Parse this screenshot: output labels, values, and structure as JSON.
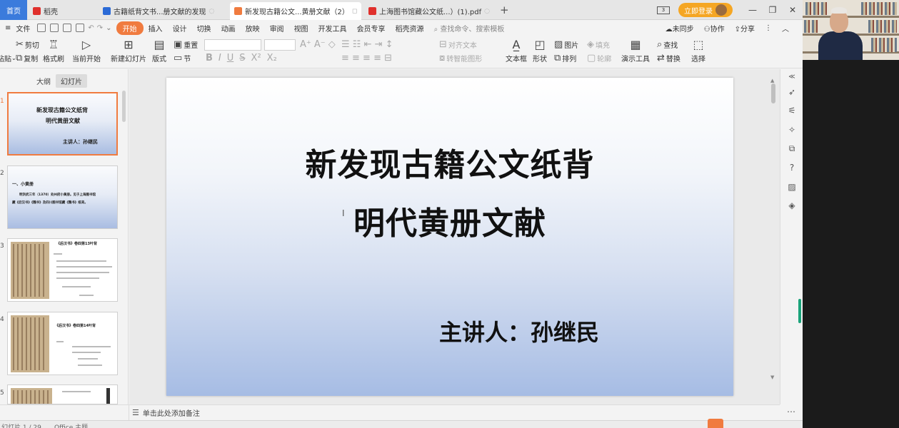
{
  "tabs": [
    {
      "label": "首页",
      "kind": "home"
    },
    {
      "label": "稻壳",
      "icon_color": "#e0302c"
    },
    {
      "label": "古籍纸背文书...册文献的发现",
      "icon_color": "#2b6ad6"
    },
    {
      "label": "新发现古籍公文...黄册文献（2）",
      "icon_color": "#f07b3f",
      "active": true
    },
    {
      "label": "上海图书馆藏公文纸...）(1).pdf",
      "icon_color": "#e0302c"
    }
  ],
  "titlebar": {
    "screen_label": "3",
    "login_label": "立即登录"
  },
  "menu": {
    "file_label": "文件",
    "items": [
      "开始",
      "插入",
      "设计",
      "切换",
      "动画",
      "放映",
      "审阅",
      "视图",
      "开发工具",
      "会员专享",
      "稻壳资源"
    ],
    "active": "开始",
    "search_placeholder": "查找命令、搜索模板",
    "sync_label": "未同步",
    "collab_label": "协作",
    "share_label": "分享"
  },
  "ribbon": {
    "paste": "粘贴",
    "cut": "剪切",
    "copy": "复制",
    "format_painter": "格式刷",
    "from_current": "当前开始",
    "new_slide": "新建幻灯片",
    "layout": "版式",
    "section": "节",
    "reset": "重置",
    "bold": "B",
    "italic": "I",
    "underline": "U",
    "strike": "S",
    "superscript": "X²",
    "subscript": "X₂",
    "align_text": "对齐文本",
    "smartart": "转智能图形",
    "textbox": "文本框",
    "shape": "形状",
    "picture": "图片",
    "arrange": "排列",
    "fill": "填充",
    "outline": "轮廓",
    "present_tools": "演示工具",
    "find": "查找",
    "replace": "替换",
    "select": "选择"
  },
  "leftpanel": {
    "tab_outline": "大纲",
    "tab_slides": "幻灯片",
    "thumbs": [
      {
        "num": "1",
        "line1": "新发现古籍公文纸背",
        "line2": "明代黄册文献",
        "line3": "主讲人：孙继民"
      },
      {
        "num": "2",
        "line1": "一、小黄册",
        "line2": "明洪武三年（1370）处州府小黄册。见于上海图书馆",
        "line3": "藏《后汉书》《魏书》及四川图书馆藏《魏书》纸背。"
      },
      {
        "num": "3",
        "line1": "《后汉书》卷四第13叶背"
      },
      {
        "num": "4",
        "line1": "《后汉书》卷四第14叶背"
      },
      {
        "num": "5"
      }
    ]
  },
  "slide": {
    "title_line1": "新发现古籍公文纸背",
    "title_line2": "明代黄册文献",
    "speaker": "主讲人：孙继民"
  },
  "notes": {
    "placeholder": "单击此处添加备注"
  },
  "statusbar": {
    "left": "幻灯片 1 / 29",
    "theme": "Office 主题"
  }
}
